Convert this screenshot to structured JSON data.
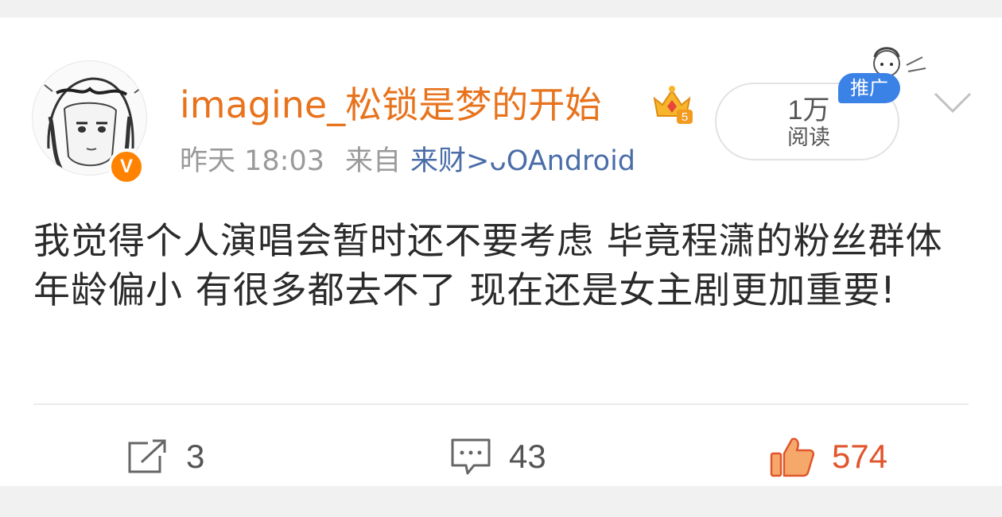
{
  "post": {
    "username": "imagine_松锁是梦的开始",
    "time": "昨天 18:03",
    "source_prefix": "来自",
    "source": "来财>ᴗOAndroid",
    "content": "我觉得个人演唱会暂时还不要考虑 毕竟程潇的粉丝群体年龄偏小 有很多都去不了 现在还是女主剧更加重要!"
  },
  "read": {
    "count": "1万",
    "label": "阅读"
  },
  "promo": {
    "label": "推广"
  },
  "avatar": {
    "badge": "V"
  },
  "crown": {
    "level": "5"
  },
  "actions": {
    "repost": {
      "count": "3",
      "icon": "repost-icon"
    },
    "comment": {
      "count": "43",
      "icon": "comment-icon"
    },
    "like": {
      "count": "574",
      "icon": "thumbs-up-icon"
    }
  },
  "colors": {
    "username": "#e8731d",
    "source": "#4a6da8",
    "like": "#e0552c",
    "verified_badge": "#ff8200",
    "promo_badge": "#3b82e6"
  }
}
